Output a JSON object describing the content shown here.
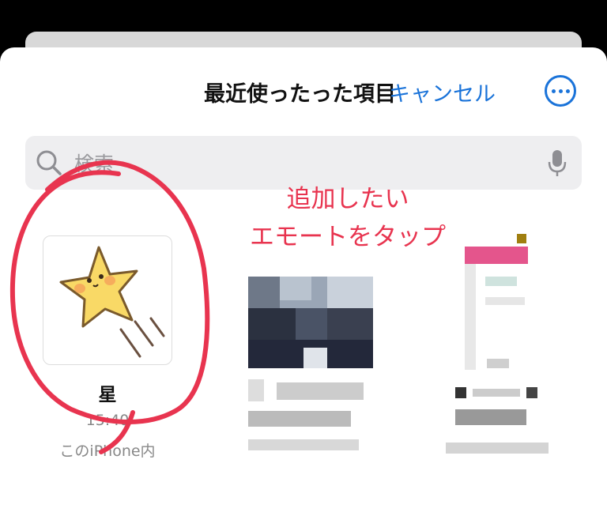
{
  "header": {
    "title": "最近使ったった項目",
    "cancel_label": "キャンセル"
  },
  "search": {
    "placeholder": "検索"
  },
  "annotation": {
    "line1": "追加したい",
    "line2": "エモートをタップ"
  },
  "items": [
    {
      "title": "星",
      "time": "15:40",
      "location": "このiPhone内",
      "thumbnail": "star-sticker"
    },
    {
      "title": "",
      "time": "",
      "location": "",
      "thumbnail": "pixelated-photo"
    },
    {
      "title": "",
      "time": "",
      "location": "",
      "thumbnail": "pixelated-document"
    }
  ],
  "colors": {
    "accent": "#1a73d9",
    "annotation": "#e8344f",
    "star_fill": "#f9d966"
  }
}
